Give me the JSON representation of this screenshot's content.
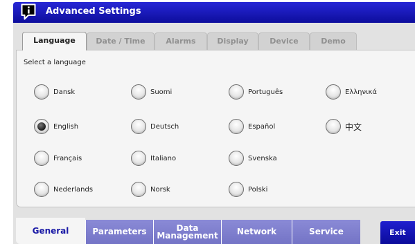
{
  "titlebar": {
    "title": "Advanced Settings",
    "icon": "info-icon"
  },
  "tabs": [
    {
      "label": "Language",
      "active": true
    },
    {
      "label": "Date / Time",
      "active": false
    },
    {
      "label": "Alarms",
      "active": false
    },
    {
      "label": "Display",
      "active": false
    },
    {
      "label": "Device",
      "active": false
    },
    {
      "label": "Demo",
      "active": false
    }
  ],
  "language": {
    "prompt": "Select a language",
    "selected": "English",
    "options": [
      "Dansk",
      "Suomi",
      "Português",
      "Ελληνικά",
      "English",
      "Deutsch",
      "Español",
      "中文",
      "Français",
      "Italiano",
      "Svenska",
      "Nederlands",
      "Norsk",
      "Polski"
    ]
  },
  "bottom_nav": {
    "tabs": [
      {
        "label": "General",
        "active": true
      },
      {
        "label": "Parameters",
        "active": false
      },
      {
        "label": "Data Management",
        "active": false
      },
      {
        "label": "Network",
        "active": false
      },
      {
        "label": "Service",
        "active": false
      }
    ],
    "exit_label": "Exit"
  },
  "colors": {
    "titlebar": "#1a1ab8",
    "bottom_tab": "#7f7fcf",
    "exit_button": "#1515b5",
    "panel": "#e2e2e2",
    "content": "#f5f5f5"
  }
}
